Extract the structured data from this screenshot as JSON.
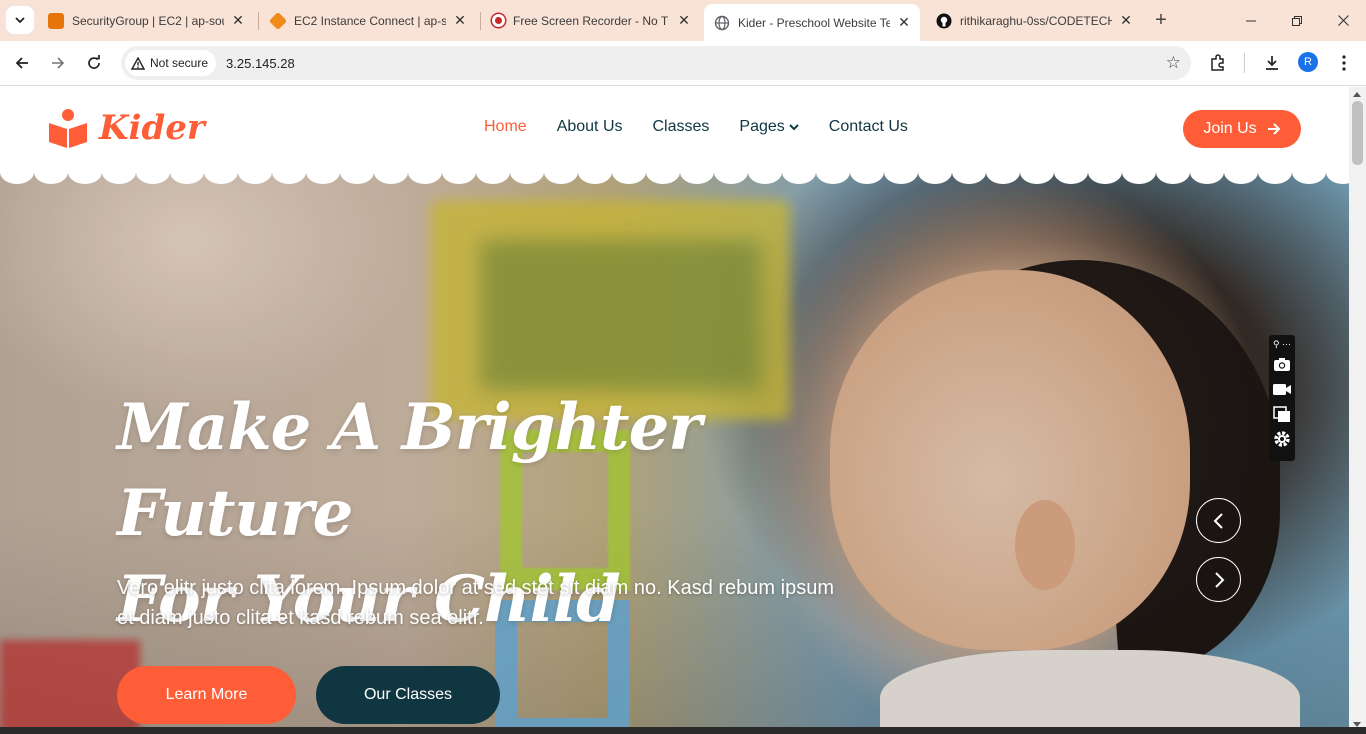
{
  "browser": {
    "tabs": [
      {
        "title": "SecurityGroup | EC2 | ap-sou",
        "favicon": "aws-icon",
        "color": "#e5760b"
      },
      {
        "title": "EC2 Instance Connect | ap-so",
        "favicon": "cube-icon",
        "color": "#f08a1b"
      },
      {
        "title": "Free Screen Recorder - No T",
        "favicon": "record-icon",
        "color": "#c62828"
      },
      {
        "title": "Kider - Preschool Website Te",
        "favicon": "globe-icon",
        "color": "#5f6368"
      },
      {
        "title": "rithikaraghu-0ss/CODETECH",
        "favicon": "github-icon",
        "color": "#111111"
      }
    ],
    "active_tab_index": 3,
    "security_label": "Not secure",
    "url": "3.25.145.28",
    "profile_initial": "R"
  },
  "site": {
    "brand": "Kider",
    "menu": [
      "Home",
      "About Us",
      "Classes",
      "Pages",
      "Contact Us"
    ],
    "active_menu": "Home",
    "join_label": "Join Us",
    "hero": {
      "title_line1": "Make A Brighter Future",
      "title_line2": "For Your Child",
      "text_line1": "Vero elitr justo clita lorem. Ipsum dolor at sed stet sit diam no. Kasd rebum ipsum",
      "text_line2": "et diam justo clita et kasd rebum sea elitr.",
      "btn_primary": "Learn More",
      "btn_secondary": "Our Classes"
    }
  },
  "colors": {
    "accent": "#fe5d37",
    "dark": "#103741",
    "tabstrip": "#f9e2d6"
  }
}
